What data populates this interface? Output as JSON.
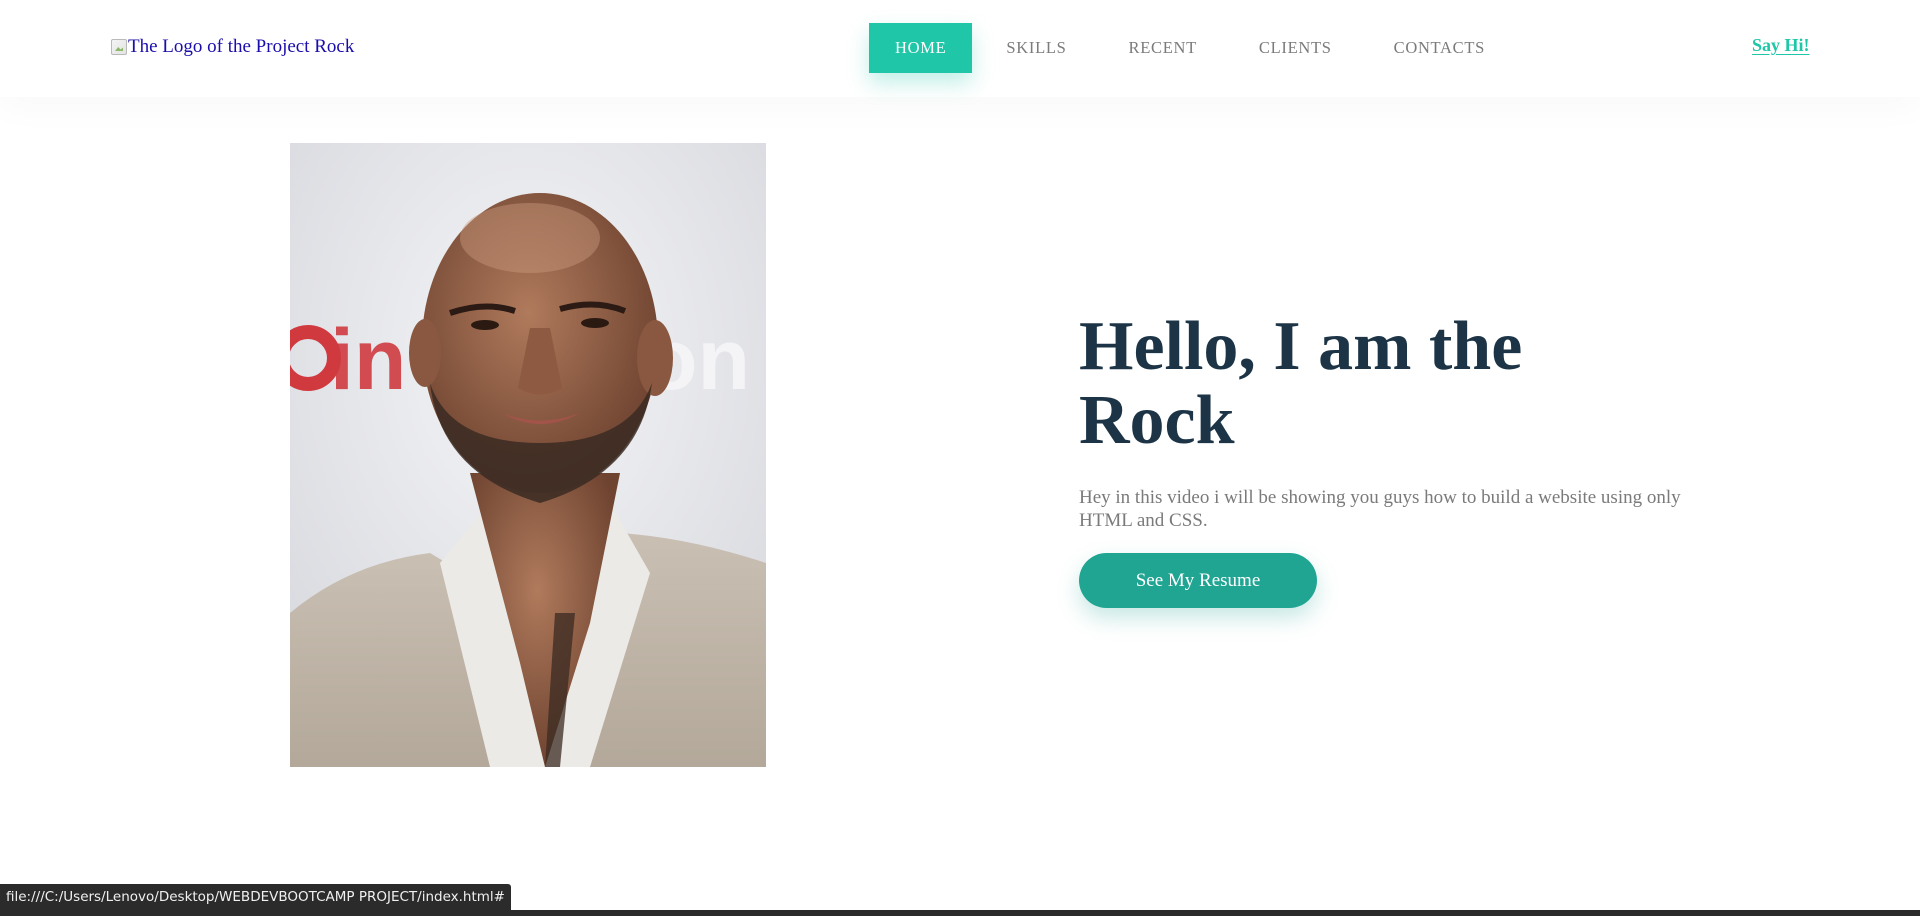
{
  "header": {
    "logo_alt": "The Logo of the Project Rock",
    "nav": {
      "home": "HOME",
      "skills": "SKILLS",
      "recent": "RECENT",
      "clients": "CLIENTS",
      "contacts": "CONTACTS"
    },
    "say_hi": "Say Hi!"
  },
  "hero": {
    "title": "Hello, I am the Rock",
    "description": "Hey in this video i will be showing you guys how to build a website using only HTML and CSS.",
    "button": "See My Resume"
  },
  "status_bar": {
    "url": "file:///C:/Users/Lenovo/Desktop/WEBDEVBOOTCAMP PROJECT/index.html#"
  },
  "colors": {
    "accent": "#1fc6a8",
    "button": "#1fa592",
    "heading": "#1c3446",
    "body_text": "#7a7a7a"
  }
}
